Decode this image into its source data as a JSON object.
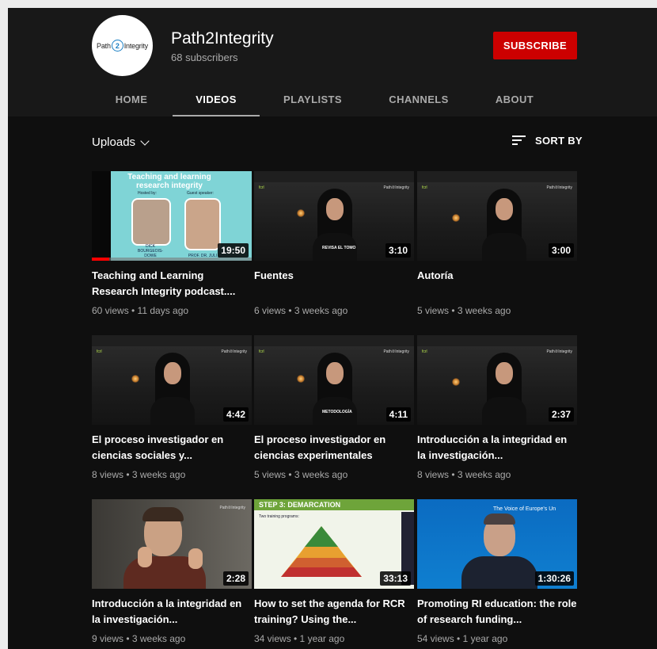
{
  "channel": {
    "avatar_text_left": "Path",
    "avatar_text_num": "2",
    "avatar_text_right": "Integrity",
    "name": "Path2Integrity",
    "subscribers": "68 subscribers",
    "subscribe_label": "SUBSCRIBE",
    "colors": {
      "subscribe": "#cc0000",
      "header_bg": "#181818",
      "page_bg": "#0f0f0f"
    }
  },
  "tabs": [
    {
      "label": "HOME"
    },
    {
      "label": "VIDEOS",
      "active": true
    },
    {
      "label": "PLAYLISTS"
    },
    {
      "label": "CHANNELS"
    },
    {
      "label": "ABOUT"
    }
  ],
  "filters": {
    "uploads_label": "Uploads",
    "sort_label": "SORT BY"
  },
  "videos": [
    {
      "title": "Teaching and Learning Research Integrity podcast....",
      "meta": "60 views • 11 days ago",
      "duration": "19:50",
      "watch_progress": 0.11,
      "thumb": {
        "heading": "Teaching and learning research integrity",
        "hosted_by": "Hosted by:",
        "guest": "Guest speaker:",
        "host_name": "DICK BOURGEOIS-DOWE",
        "guest_name": "PROF. DR. JULI"
      }
    },
    {
      "title": "Fuentes",
      "meta": "6 views • 3 weeks ago",
      "duration": "3:10",
      "thumb": {
        "logo_l": "fcrl",
        "logo_r": "Path②Integrity",
        "caption": "REVISA EL TOMO"
      }
    },
    {
      "title": "Autoría",
      "meta": "5 views • 3 weeks ago",
      "duration": "3:00",
      "thumb": {
        "logo_l": "fcrl",
        "logo_r": "Path②Integrity",
        "caption": ""
      }
    },
    {
      "title": "El proceso investigador en ciencias sociales y...",
      "meta": "8 views • 3 weeks ago",
      "duration": "4:42",
      "thumb": {
        "logo_l": "fcrl",
        "logo_r": "Path②Integrity",
        "caption": ""
      }
    },
    {
      "title": "El proceso investigador en ciencias experimentales",
      "meta": "5 views • 3 weeks ago",
      "duration": "4:11",
      "thumb": {
        "logo_l": "fcrl",
        "logo_r": "Path②Integrity",
        "caption": "METODOLOGÍA"
      }
    },
    {
      "title": "Introducción a la integridad en la investigación...",
      "meta": "8 views • 3 weeks ago",
      "duration": "2:37",
      "thumb": {
        "logo_l": "fcrl",
        "logo_r": "Path②Integrity",
        "caption": ""
      }
    },
    {
      "title": "Introducción a la integridad en la investigación...",
      "meta": "9 views • 3 weeks ago",
      "duration": "2:28",
      "thumb": {
        "logo_r": "Path②Integrity"
      }
    },
    {
      "title": "How to set the agenda for RCR training? Using the...",
      "meta": "34 views • 1 year ago",
      "duration": "33:13",
      "thumb": {
        "heading": "STEP 3: DEMARCATION",
        "sub": "Two training programs:"
      }
    },
    {
      "title": "Promoting RI education: the role of research funding...",
      "meta": "54 views • 1 year ago",
      "duration": "1:30:26",
      "thumb": {
        "heading": "The Voice of Europe's Un"
      }
    }
  ]
}
